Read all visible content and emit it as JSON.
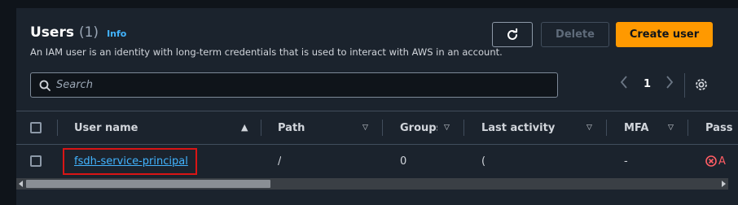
{
  "header": {
    "title": "Users",
    "count": "(1)",
    "info_link": "Info",
    "description": "An IAM user is an identity with long-term credentials that is used to interact with AWS in an account."
  },
  "toolbar": {
    "refresh_icon": "refresh-icon",
    "delete_label": "Delete",
    "create_label": "Create user"
  },
  "search": {
    "placeholder": "Search",
    "value": ""
  },
  "pagination": {
    "current_page": "1",
    "prev_icon": "chevron-left-icon",
    "next_icon": "chevron-right-icon",
    "settings_icon": "gear-icon"
  },
  "table": {
    "columns": [
      {
        "label": "User name",
        "sort": "ascending"
      },
      {
        "label": "Path",
        "sort": "none"
      },
      {
        "label": "Groups",
        "sort": "none"
      },
      {
        "label": "Last activity",
        "sort": "none"
      },
      {
        "label": "MFA",
        "sort": "none"
      },
      {
        "label": "Pass",
        "sort": "none"
      }
    ],
    "rows": [
      {
        "user_name": "fsdh-service-principal",
        "path": "/",
        "groups": "0",
        "last_activity": "(",
        "mfa": "-",
        "password_age": "A"
      }
    ]
  },
  "colors": {
    "accent_orange": "#ff9900",
    "link_blue": "#42b4ff",
    "highlight_red": "#d91515",
    "panel_bg": "#1b232d",
    "page_bg": "#0f141a"
  }
}
